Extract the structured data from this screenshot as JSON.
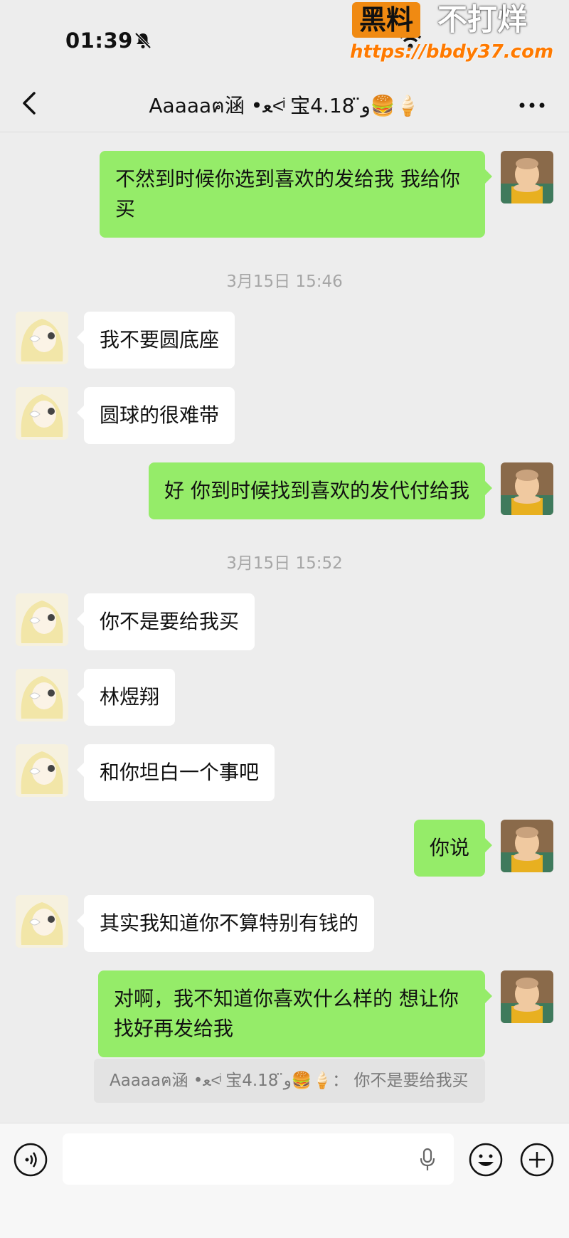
{
  "status": {
    "time": "01:39"
  },
  "watermark": {
    "brand": "黑料",
    "slogan": "不打烊",
    "url": "https://bbdy37.com"
  },
  "header": {
    "title": "Aaaaaฅ涵 •ﻌ<ͥ 宝ﻭ̈ 4.18🍔🍦"
  },
  "messages": [
    {
      "side": "right",
      "text": "不然到时候你选到喜欢的发给我 我给你买"
    },
    {
      "type": "time",
      "text": "3月15日 15:46"
    },
    {
      "side": "left",
      "text": "我不要圆底座"
    },
    {
      "side": "left",
      "text": "圆球的很难带"
    },
    {
      "side": "right",
      "text": "好 你到时候找到喜欢的发代付给我"
    },
    {
      "type": "time",
      "text": "3月15日 15:52"
    },
    {
      "side": "left",
      "text": "你不是要给我买"
    },
    {
      "side": "left",
      "text": "林煜翔"
    },
    {
      "side": "left",
      "text": "和你坦白一个事吧"
    },
    {
      "side": "right",
      "text": "你说"
    },
    {
      "side": "left",
      "text": "其实我知道你不算特别有钱的"
    },
    {
      "side": "right",
      "text": "对啊，我不知道你喜欢什么样的 想让你找好再发给我"
    }
  ],
  "quote": {
    "text": "Aaaaaฅ涵 •ﻌ<ͥ 宝ﻭ̈ 4.18🍔🍦： 你不是要给我买"
  },
  "input": {
    "value": ""
  },
  "icons": [
    "bell-off-icon",
    "wifi-icon",
    "back-icon",
    "more-icon",
    "voice-icon",
    "mic-icon",
    "emoji-icon",
    "plus-icon"
  ]
}
